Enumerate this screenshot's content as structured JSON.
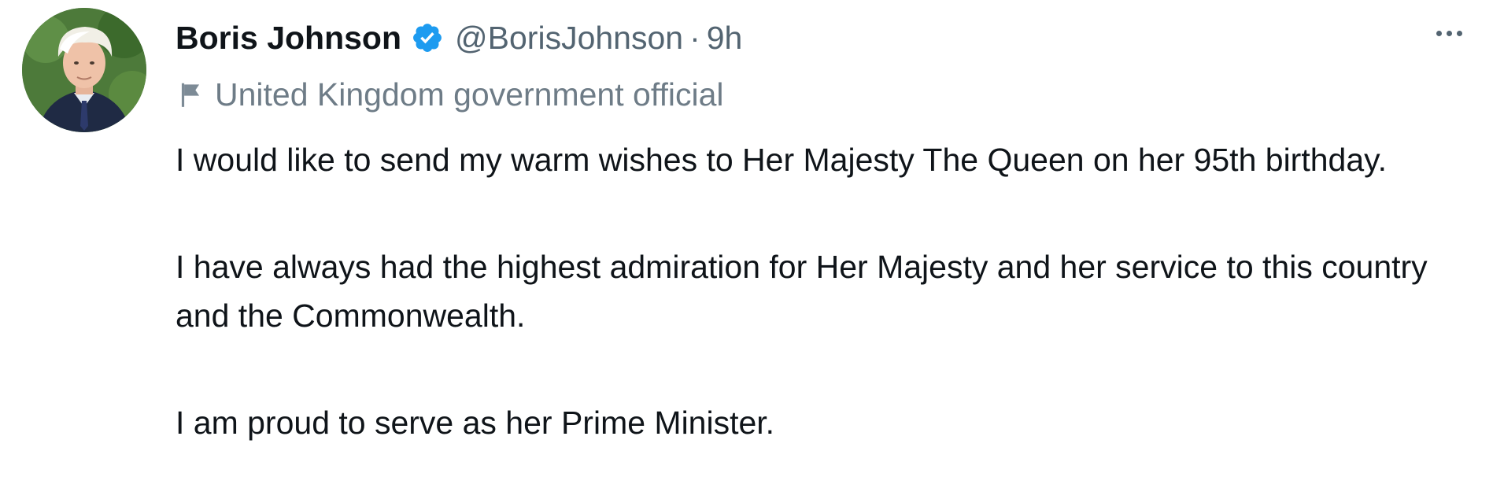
{
  "tweet": {
    "author": {
      "display_name": "Boris Johnson",
      "handle": "@BorisJohnson",
      "verified": true,
      "avatar_icon": "profile-photo"
    },
    "separator": "·",
    "timestamp": "9h",
    "account_label": {
      "icon": "flag-icon",
      "text": "United Kingdom government official"
    },
    "paragraphs": [
      "I would like to send my warm wishes to Her Majesty The Queen on her 95th birthday.",
      "I have always had the highest admiration for Her Majesty and her service to this country and the Commonwealth.",
      "I am proud to serve as her Prime Minister."
    ]
  },
  "colors": {
    "text_primary": "#0f1419",
    "text_secondary": "#536471",
    "verified_blue": "#1d9bf0"
  }
}
